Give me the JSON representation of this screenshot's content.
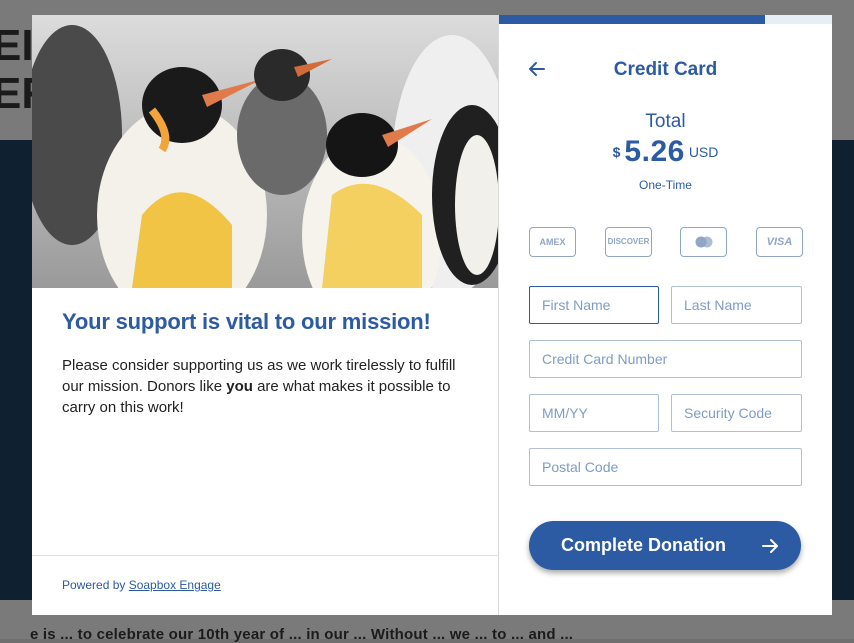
{
  "background": {
    "heading_lines": [
      "EI",
      "ER"
    ],
    "body_text": "e is ... to celebrate our 10th year of ... in our ... Without ... we ... to ... and ... "
  },
  "left_panel": {
    "headline": "Your support is vital to our mission!",
    "body_before": "Please consider supporting us as we work tirelessly to fulfill our mission. Donors like ",
    "body_bold": "you",
    "body_after": " are what makes it possible to carry on this work!",
    "footer_prefix": "Powered by ",
    "footer_link": "Soapbox Engage"
  },
  "right_panel": {
    "progress_fraction": 0.8,
    "back_icon": "arrow-left-icon",
    "title": "Credit Card",
    "total_label": "Total",
    "currency_symbol": "$",
    "amount": "5.26",
    "currency_code": "USD",
    "frequency": "One-Time",
    "cards": {
      "amex": "AMEX",
      "discover": "DISCOVER",
      "visa": "VISA"
    },
    "fields": {
      "first_name": "First Name",
      "last_name": "Last Name",
      "card_number": "Credit Card Number",
      "expiry": "MM/YY",
      "security_code": "Security Code",
      "postal_code": "Postal Code"
    },
    "submit_label": "Complete Donation"
  },
  "colors": {
    "brand_blue": "#2c5ba3",
    "field_border": "#aebfd6",
    "placeholder": "#7f9cc6",
    "overlay": "#6f6f6f"
  }
}
